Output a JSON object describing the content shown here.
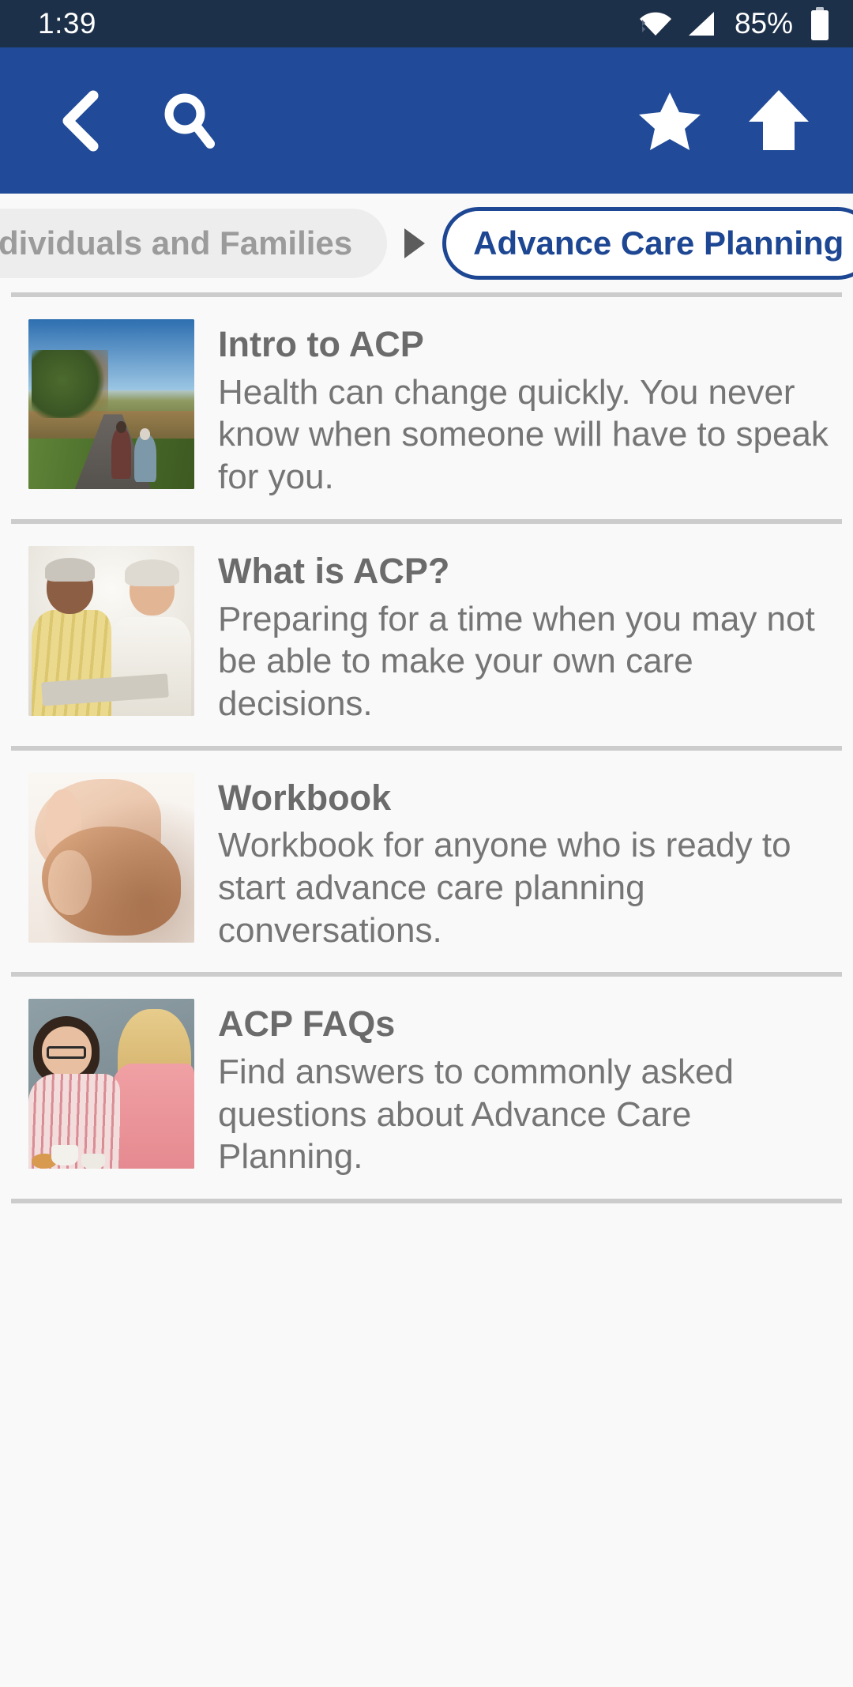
{
  "status_bar": {
    "time": "1:39",
    "battery_percent": "85%",
    "icons": [
      "wifi-icon",
      "cellular-signal-icon",
      "battery-icon"
    ],
    "background_color": "#1D3049"
  },
  "toolbar": {
    "background_color": "#214B98",
    "buttons": [
      {
        "name": "back-button",
        "icon": "chevron-left-icon"
      },
      {
        "name": "search-button",
        "icon": "search-icon"
      },
      {
        "name": "favorite-button",
        "icon": "star-icon"
      },
      {
        "name": "home-button",
        "icon": "home-up-arrow-icon"
      }
    ]
  },
  "breadcrumb": {
    "parent_label": "dividuals and Families",
    "separator": "triangle-right-icon",
    "current_label": "Advance Care Planning",
    "parent_color": "#9B9B9B",
    "current_color": "#1D4693"
  },
  "list": {
    "items": [
      {
        "title": "Intro to ACP",
        "description": "Health can change quickly. You never know when someone will have to speak for you.",
        "thumbnail": "older-couple-walking-autumn-path-photo"
      },
      {
        "title": "What is ACP?",
        "description": "Preparing for a time when you may not be able to make your own care decisions.",
        "thumbnail": "senior-couple-reading-together-photo"
      },
      {
        "title": "Workbook",
        "description": "Workbook for anyone who is ready to start advance care planning conversations.",
        "thumbnail": "holding-hands-closeup-photo"
      },
      {
        "title": "ACP FAQs",
        "description": "Find answers to commonly asked questions about Advance Care Planning.",
        "thumbnail": "two-women-talking-coffee-photo"
      }
    ]
  }
}
